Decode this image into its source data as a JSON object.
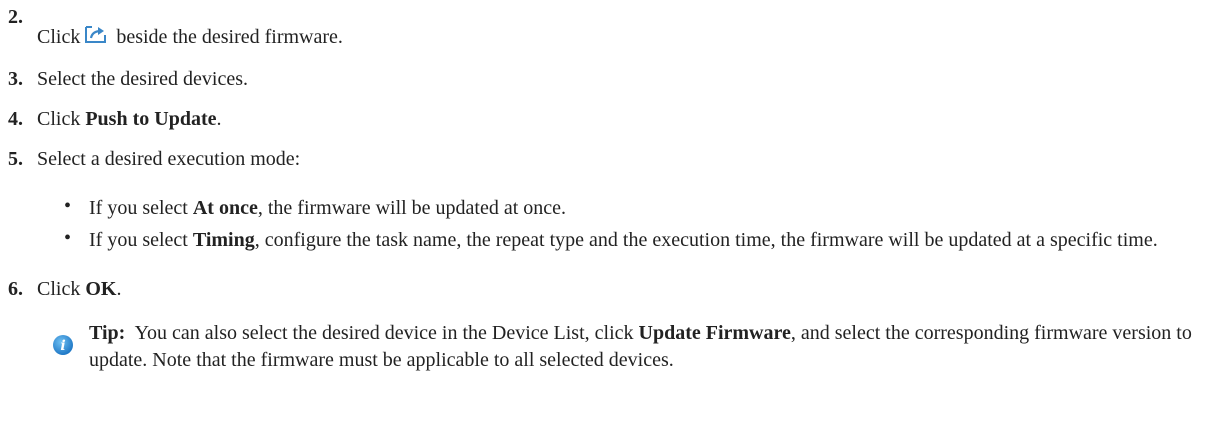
{
  "steps": [
    {
      "number": "2.",
      "before": "Click",
      "after": "beside the desired firmware."
    },
    {
      "number": "3.",
      "text": "Select the desired devices."
    },
    {
      "number": "4.",
      "before": "Click",
      "bold": "Push to Update",
      "after": "."
    },
    {
      "number": "5.",
      "text": "Select a desired execution mode:"
    },
    {
      "number": "6.",
      "before": "Click",
      "bold": "OK",
      "after": "."
    }
  ],
  "bullets": [
    {
      "symbol": "•",
      "before": "If you select",
      "bold": "At once",
      "after": ", the firmware will be updated at once."
    },
    {
      "symbol": "•",
      "before": "If you select",
      "bold": "Timing",
      "after": ", configure the task name, the repeat type and the execution time, the firmware will be updated at a specific time."
    }
  ],
  "tip": {
    "label": "Tip:",
    "before": "You can also select the desired device in the Device List, click",
    "bold": "Update Firmware",
    "after": ", and select the corresponding firmware version to update. Note that the firmware must be applicable to all selected devices."
  },
  "icons": {
    "push": "push-share-icon",
    "tip": "info-icon",
    "accent": "#2e8fd6"
  }
}
